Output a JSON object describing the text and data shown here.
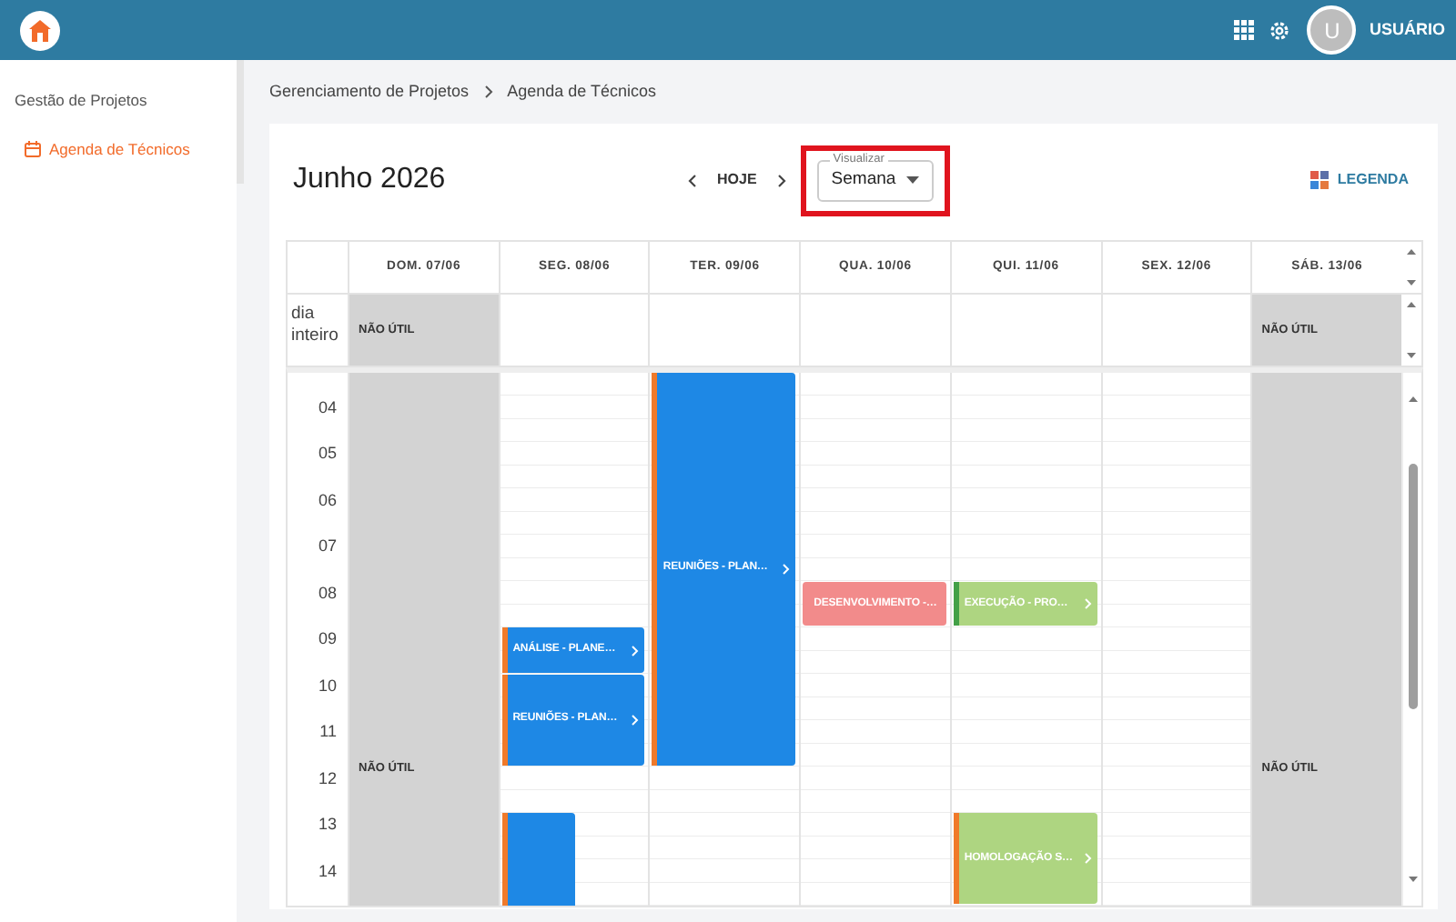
{
  "topbar": {
    "avatar_initial": "U",
    "user": "USUÁRIO"
  },
  "sidebar": {
    "section": "Gestão de Projetos",
    "items": [
      {
        "label": "Agenda de Técnicos",
        "selected": true
      }
    ]
  },
  "breadcrumb": [
    "Gerenciamento de Projetos",
    "Agenda de Técnicos"
  ],
  "toolbar": {
    "title": "Junho 2026",
    "today": "HOJE",
    "view_select": {
      "label": "Visualizar",
      "value": "Semana",
      "highlighted": true
    },
    "legend": "LEGENDA"
  },
  "calendar": {
    "all_day_label": "dia inteiro",
    "hours": [
      "04",
      "05",
      "06",
      "07",
      "08",
      "09",
      "10",
      "11",
      "12",
      "13",
      "14"
    ],
    "days": [
      {
        "label": "DOM. 07/06",
        "non_working": true,
        "all_day_text": "NÃO ÚTIL",
        "body_text": "NÃO ÚTIL"
      },
      {
        "label": "SEG. 08/06",
        "non_working": false,
        "events": [
          {
            "title": "ANÁLISE - PLANE…",
            "color": "#1e88e5",
            "marker": {
              "color": "#f07a2a"
            },
            "chevron": true,
            "overlap": false
          },
          {
            "title": "REUNIÕES - PLAN…",
            "color": "#1e88e5",
            "marker": {
              "color": "#f07a2a"
            },
            "chevron": true,
            "overlap": false
          },
          {
            "color": "#1e88e5",
            "marker": {
              "color": "#f07a2a"
            },
            "chevron": false,
            "overlap": true
          }
        ]
      },
      {
        "label": "TER. 09/06",
        "non_working": false,
        "events": [
          {
            "title": "REUNIÕES - PLAN…",
            "color": "#1e88e5",
            "marker": {
              "color": "#f07a2a"
            },
            "chevron": true,
            "overlap": false
          }
        ]
      },
      {
        "label": "QUA. 10/06",
        "non_working": false,
        "events": [
          {
            "title": "DESENVOLVIMENTO -…",
            "color": "#f28b8b",
            "chevron": false,
            "overlap": false
          }
        ]
      },
      {
        "label": "QUI. 11/06",
        "non_working": false,
        "events": [
          {
            "title": "EXECUÇÃO - PRO…",
            "color": "#aed581",
            "marker": {
              "color": "#43a047"
            },
            "chevron": true,
            "overlap": false
          },
          {
            "title": "HOMOLOGAÇÃO S…",
            "color": "#aed581",
            "marker": {
              "color": "#f07a2a"
            },
            "chevron": true,
            "overlap": false
          }
        ]
      },
      {
        "label": "SEX. 12/06",
        "non_working": false
      },
      {
        "label": "SÁB. 13/06",
        "non_working": true,
        "all_day_text": "NÃO ÚTIL",
        "body_text": "NÃO ÚTIL"
      }
    ]
  }
}
